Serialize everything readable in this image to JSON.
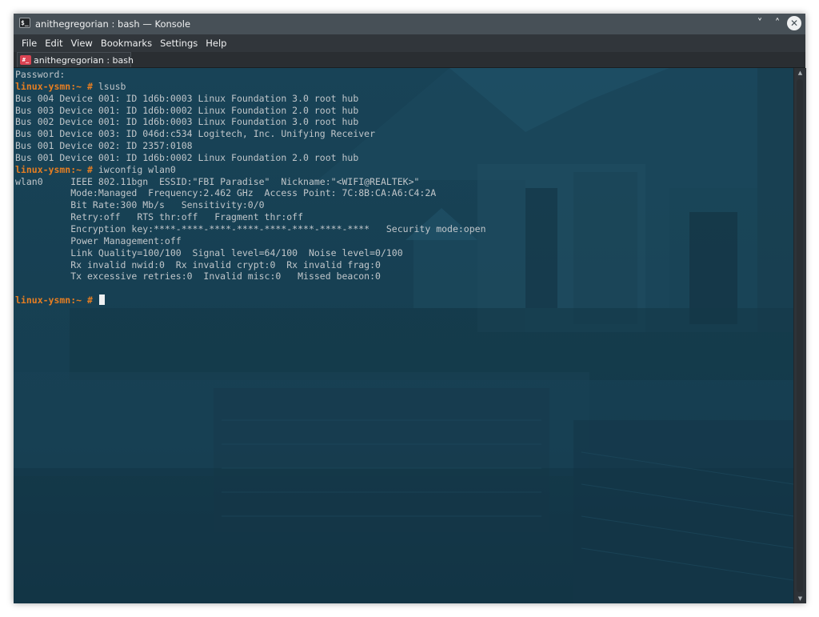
{
  "window": {
    "title": "anithegregorian : bash — Konsole",
    "app_icon": "terminal-app-icon",
    "controls": {
      "minimize": "˅",
      "maximize": "˄",
      "close": "✕"
    }
  },
  "menu": [
    {
      "label": "File"
    },
    {
      "label": "Edit"
    },
    {
      "label": "View"
    },
    {
      "label": "Bookmarks"
    },
    {
      "label": "Settings"
    },
    {
      "label": "Help"
    }
  ],
  "tab": {
    "label": "anithegregorian : bash",
    "icon": "terminal-tab-icon"
  },
  "terminal": {
    "colors": {
      "prompt": "#e67e22",
      "text": "#c0c6ca",
      "background": "#184357"
    },
    "lines": [
      {
        "text": "Password:"
      },
      {
        "prompt": "linux-ysmn:~ #",
        "text": " lsusb"
      },
      {
        "text": "Bus 004 Device 001: ID 1d6b:0003 Linux Foundation 3.0 root hub"
      },
      {
        "text": "Bus 003 Device 001: ID 1d6b:0002 Linux Foundation 2.0 root hub"
      },
      {
        "text": "Bus 002 Device 001: ID 1d6b:0003 Linux Foundation 3.0 root hub"
      },
      {
        "text": "Bus 001 Device 003: ID 046d:c534 Logitech, Inc. Unifying Receiver"
      },
      {
        "text": "Bus 001 Device 002: ID 2357:0108"
      },
      {
        "text": "Bus 001 Device 001: ID 1d6b:0002 Linux Foundation 2.0 root hub"
      },
      {
        "prompt": "linux-ysmn:~ #",
        "text": " iwconfig wlan0"
      },
      {
        "text": "wlan0     IEEE 802.11bgn  ESSID:\"FBI Paradise\"  Nickname:\"<WIFI@REALTEK>\""
      },
      {
        "text": "          Mode:Managed  Frequency:2.462 GHz  Access Point: 7C:8B:CA:A6:C4:2A"
      },
      {
        "text": "          Bit Rate:300 Mb/s   Sensitivity:0/0"
      },
      {
        "text": "          Retry:off   RTS thr:off   Fragment thr:off"
      },
      {
        "text": "          Encryption key:****-****-****-****-****-****-****-****   Security mode:open"
      },
      {
        "text": "          Power Management:off"
      },
      {
        "text": "          Link Quality=100/100  Signal level=64/100  Noise level=0/100"
      },
      {
        "text": "          Rx invalid nwid:0  Rx invalid crypt:0  Rx invalid frag:0"
      },
      {
        "text": "          Tx excessive retries:0  Invalid misc:0   Missed beacon:0"
      },
      {
        "text": ""
      },
      {
        "prompt": "linux-ysmn:~ #",
        "text": " ",
        "cursor": true
      }
    ]
  },
  "scrollbar": {
    "up_icon": "▲",
    "down_icon": "▼"
  }
}
